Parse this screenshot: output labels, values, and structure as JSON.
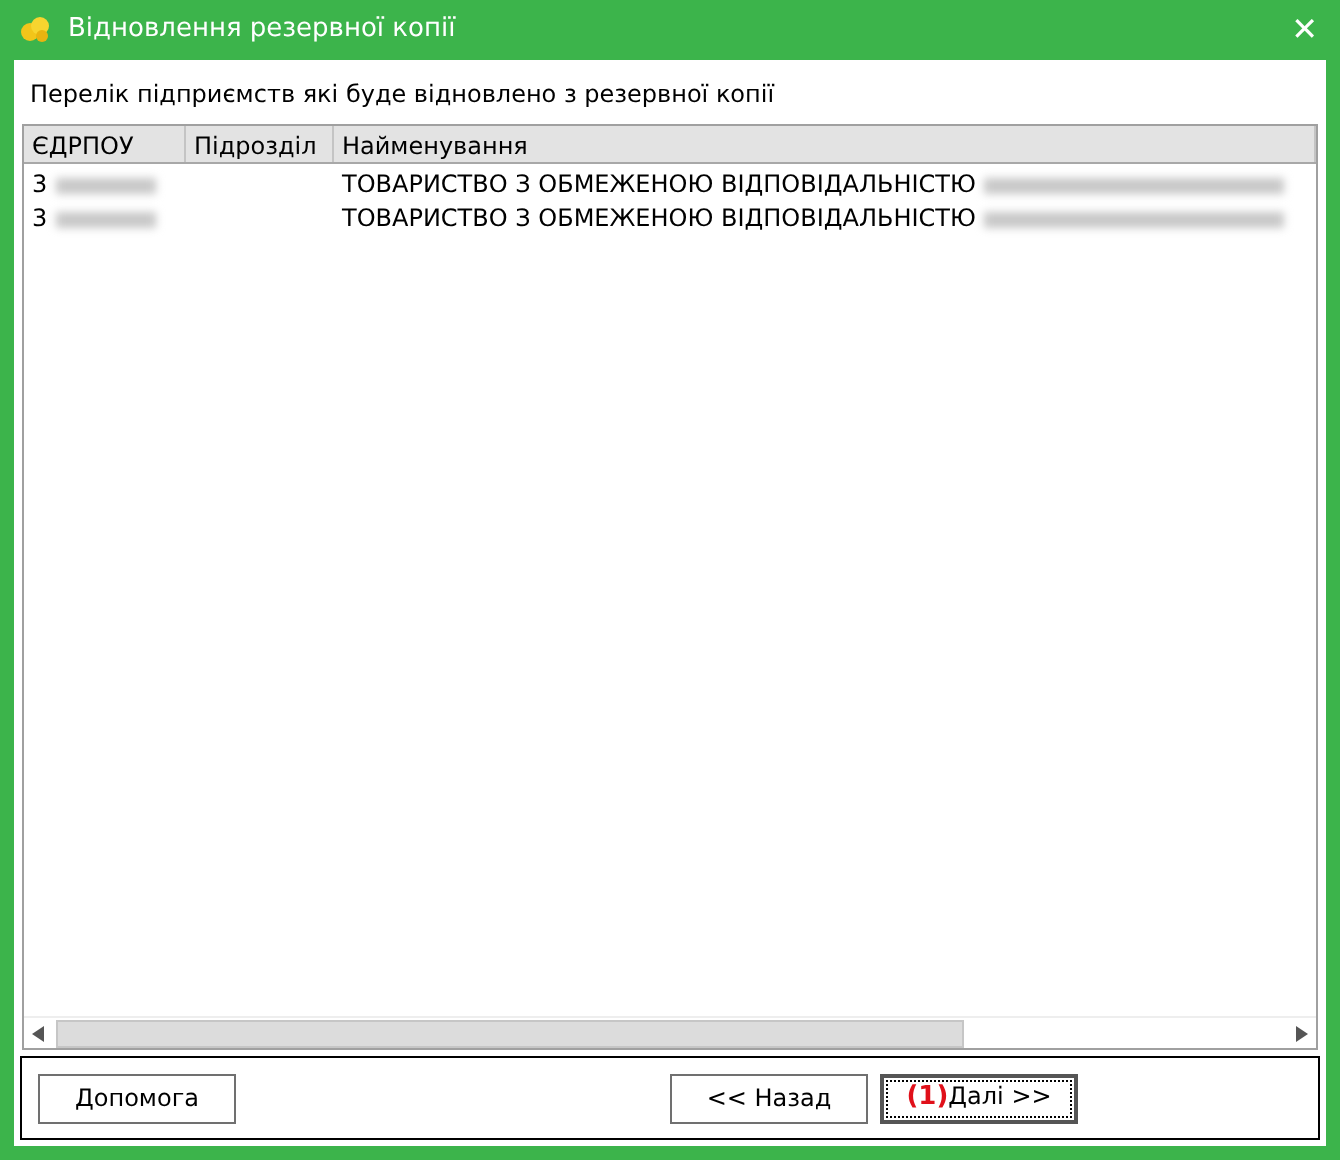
{
  "window": {
    "title": "Відновлення резервної копії",
    "close": "✕"
  },
  "caption": "Перелік підприємств які буде відновлено з резервної копії",
  "table": {
    "columns": [
      "ЄДРПОУ",
      "Підрозділ",
      "Найменування"
    ],
    "rows": [
      {
        "cells": [
          "3",
          "",
          "ТОВАРИСТВО З ОБМЕЖЕНОЮ ВІДПОВІДАЛЬНІСТЮ"
        ],
        "redacted": true
      },
      {
        "cells": [
          "3",
          "",
          "ТОВАРИСТВО З ОБМЕЖЕНОЮ ВІДПОВІДАЛЬНІСТЮ"
        ],
        "redacted": true
      }
    ]
  },
  "buttons": [
    {
      "kind": "left",
      "label": "Допомога",
      "focused": false
    },
    {
      "kind": "right",
      "label": "<< Назад",
      "focused": false
    },
    {
      "kind": "right",
      "marker": "(1)",
      "label": "Далі >>",
      "focused": true
    }
  ]
}
